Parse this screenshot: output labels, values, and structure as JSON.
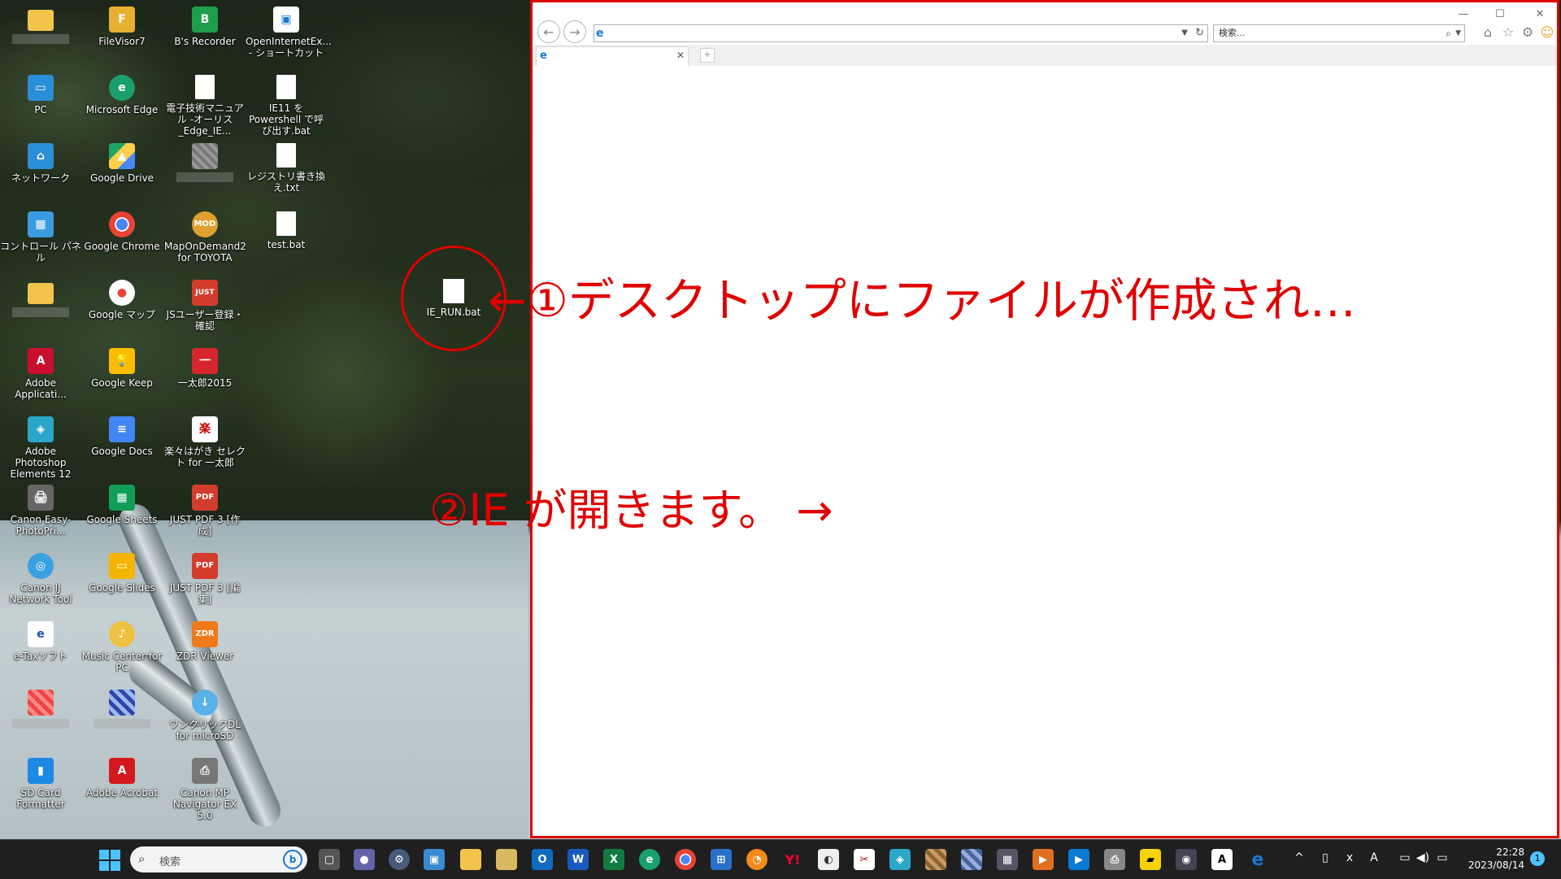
{
  "desktop": {
    "icons": [
      {
        "label": "",
        "icon": "folder-icon"
      },
      {
        "label": "FileVisor7",
        "icon": "filevisor-icon"
      },
      {
        "label": "B's Recorder",
        "icon": "bs-recorder-icon"
      },
      {
        "label": "OpenInternetEx... - ショートカット",
        "icon": "shortcut-icon"
      },
      {
        "label": "PC",
        "icon": "pc-icon"
      },
      {
        "label": "Microsoft Edge",
        "icon": "edge-icon"
      },
      {
        "label": "電子技術マニュアル -オーリス_Edge_IE...",
        "icon": "document-icon"
      },
      {
        "label": "IE11 を Powershell で呼び出す.bat",
        "icon": "bat-file-icon"
      },
      {
        "label": "ネットワーク",
        "icon": "network-icon"
      },
      {
        "label": "Google Drive",
        "icon": "google-drive-icon"
      },
      {
        "label": "",
        "icon": "blurred-icon"
      },
      {
        "label": "レジストリ書き換え.txt",
        "icon": "text-file-icon"
      },
      {
        "label": "コントロール パネル",
        "icon": "control-panel-icon"
      },
      {
        "label": "Google Chrome",
        "icon": "chrome-icon"
      },
      {
        "label": "MapOnDemand2 for TOYOTA",
        "icon": "mod-icon"
      },
      {
        "label": "test.bat",
        "icon": "bat-file-icon"
      },
      {
        "label": "",
        "icon": "folder-icon"
      },
      {
        "label": "Google マップ",
        "icon": "google-maps-icon"
      },
      {
        "label": "JSユーザー登録・確認",
        "icon": "just-icon"
      },
      {
        "label": "Adobe Applicati...",
        "icon": "adobe-icon"
      },
      {
        "label": "Google Keep",
        "icon": "google-keep-icon"
      },
      {
        "label": "一太郎2015",
        "icon": "ichitaro-icon"
      },
      {
        "label": "Adobe Photoshop Elements 12",
        "icon": "photoshop-icon"
      },
      {
        "label": "Google Docs",
        "icon": "google-docs-icon"
      },
      {
        "label": "楽々はがき セレクト for 一太郎",
        "icon": "hagaki-icon"
      },
      {
        "label": "Canon Easy-PhotoPri...",
        "icon": "canon-printer-icon"
      },
      {
        "label": "Google Sheets",
        "icon": "google-sheets-icon"
      },
      {
        "label": "JUST PDF 3 [作成]",
        "icon": "pdf-icon"
      },
      {
        "label": "Canon IJ Network Tool",
        "icon": "canon-network-icon"
      },
      {
        "label": "Google Slides",
        "icon": "google-slides-icon"
      },
      {
        "label": "JUST PDF 3 [編集]",
        "icon": "pdf-icon"
      },
      {
        "label": "e-Taxソフト",
        "icon": "etax-icon"
      },
      {
        "label": "Music Center for PC",
        "icon": "music-center-icon"
      },
      {
        "label": "ZDR Viewer",
        "icon": "zdr-viewer-icon"
      },
      {
        "label": "",
        "icon": "blurred-icon"
      },
      {
        "label": "",
        "icon": "blurred-icon"
      },
      {
        "label": "ワンクリックDL for microSD",
        "icon": "oneclick-dl-icon"
      },
      {
        "label": "SD Card Formatter",
        "icon": "sd-card-icon"
      },
      {
        "label": "Adobe Acrobat",
        "icon": "acrobat-icon"
      },
      {
        "label": "Canon MP Navigator EX 5.0",
        "icon": "mp-navigator-icon"
      }
    ],
    "created_file": {
      "label": "IE_RUN.bat",
      "icon": "bat-file-icon"
    }
  },
  "annotations": {
    "step1": "①デスクトップにファイルが作成され…",
    "step2": "②IE が開きます。 →",
    "arrow": "←",
    "color": "#e00000"
  },
  "browser": {
    "address_value": "",
    "search_placeholder": "検索...",
    "tab_title": "",
    "window_controls": [
      "—",
      "☐",
      "✕"
    ]
  },
  "taskbar": {
    "search_placeholder": "検索",
    "apps": [
      "task-view",
      "teams-chat",
      "settings",
      "photos",
      "file-explorer",
      "file-explorer-2",
      "outlook",
      "word",
      "excel",
      "edge",
      "chrome",
      "store",
      "app-orange",
      "yahoo",
      "app-gray",
      "snipping",
      "adobe",
      "app-pixel",
      "app-pixel-2",
      "calculator",
      "video",
      "media-player",
      "canon",
      "sticky-notes",
      "camera",
      "acrobat",
      "internet-explorer"
    ],
    "clock_time": "22:28",
    "clock_date": "2023/08/14",
    "notification_count": "1"
  }
}
